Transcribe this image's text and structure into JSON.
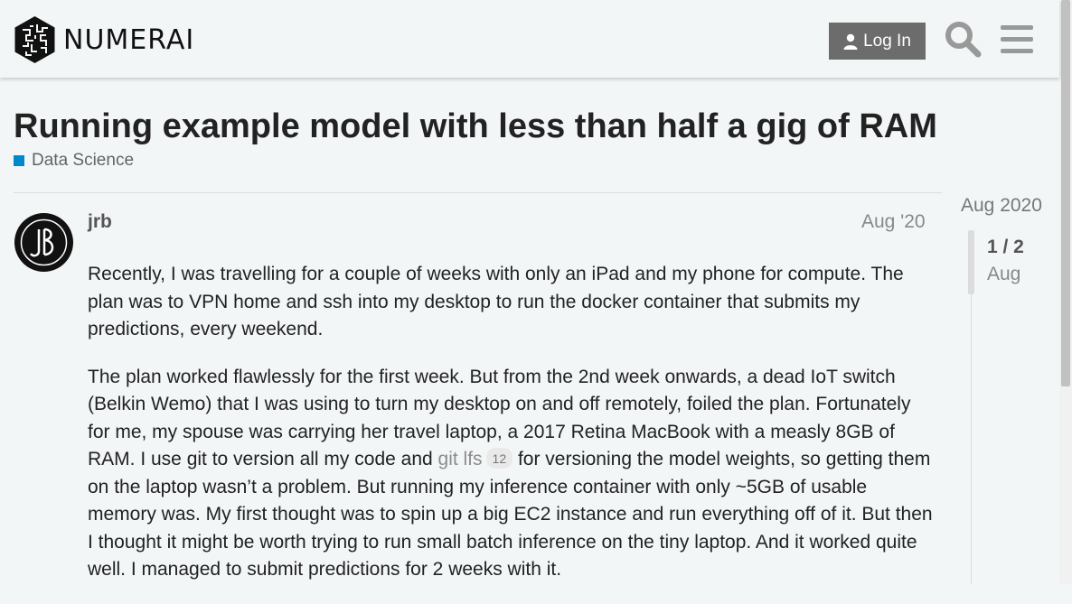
{
  "header": {
    "brand": "NUMERAI",
    "login_label": "Log In",
    "icons": {
      "login": "user-icon",
      "search": "search-icon",
      "menu": "hamburger-icon"
    }
  },
  "topic": {
    "title": "Running example model with less than half a gig of RAM",
    "category": "Data Science",
    "category_color": "#0088cc"
  },
  "post": {
    "username": "jrb",
    "date": "Aug '20",
    "paragraph1": "Recently, I was travelling for a couple of weeks with only an iPad and my phone for compute. The plan was to VPN home and ssh into my desktop to run the docker container that submits my predictions, every weekend.",
    "paragraph2_a": "The plan worked flawlessly for the first week. But from the 2nd week onwards, a dead IoT switch (Belkin Wemo) that I was using to turn my desktop on and off remotely, foiled the plan. Fortunately for me, my spouse was carrying her travel laptop, a 2017 Retina MacBook with a measly 8GB of RAM. I use git to version all my code and ",
    "link_text": "git lfs",
    "link_clicks": "12",
    "paragraph2_b": " for versioning the model weights, so getting them on the laptop wasn’t a problem. But running my inference container with only ~5GB of usable memory was. My first thought was to spin up a big EC2 instance and run everything off of it. But then I thought it might be worth trying to run small batch inference on the tiny laptop. And it worked quite well. I managed to submit predictions for 2 weeks with it."
  },
  "timeline": {
    "start_date": "Aug 2020",
    "position": "1 / 2",
    "current_date": "Aug"
  }
}
